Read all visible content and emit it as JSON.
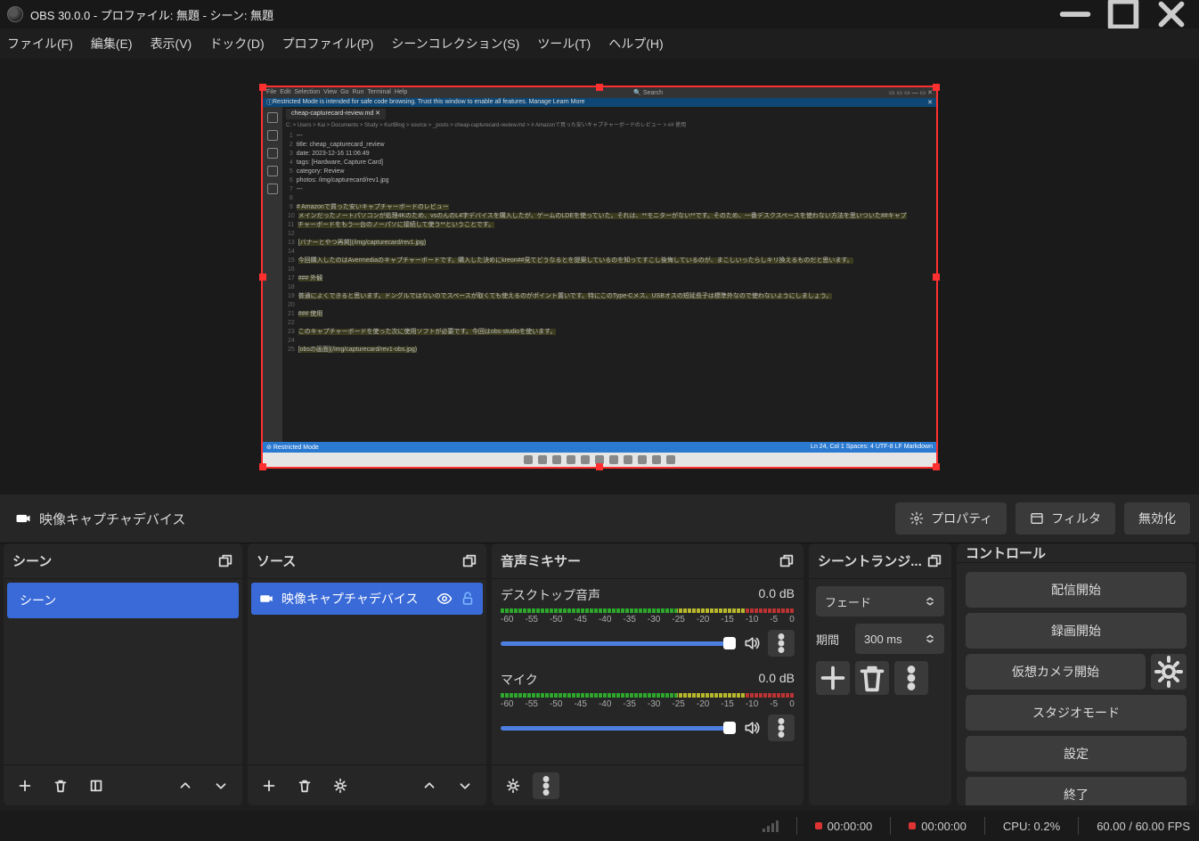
{
  "window": {
    "title": "OBS 30.0.0 - プロファイル: 無題 - シーン: 無題"
  },
  "menu": {
    "file": "ファイル(F)",
    "edit": "編集(E)",
    "view": "表示(V)",
    "dock": "ドック(D)",
    "profile": "プロファイル(P)",
    "scenecol": "シーンコレクション(S)",
    "tools": "ツール(T)",
    "help": "ヘルプ(H)"
  },
  "vscode": {
    "menus": [
      "File",
      "Edit",
      "Selection",
      "View",
      "Go",
      "Run",
      "Terminal",
      "Help"
    ],
    "search_placeholder": "Search",
    "banner": "Restricted Mode is intended for safe code browsing. Trust this window to enable all features.   Manage   Learn More",
    "tab": "cheap-capturecard-review.md",
    "breadcrumb": "C: > Users > Kai > Documents > Study > KurtBlog > source > _posts > cheap-capturecard-review.md > # Amazonで買った安いキャプチャーボードのレビュー > ## 使用",
    "lines": [
      "---",
      "title: cheap_capturecard_review",
      "date: 2023-12-16 11:06:49",
      "tags: [Hardware, Capture Card]",
      "category: Review",
      "photos: /img/capturecard/rev1.jpg",
      "---",
      "",
      "# Amazonで買った安いキャプチャーボードのレビュー",
      "メインだったノートパソコンが処理4Kのため、vsのんのL4字デバイスを購入したが、ゲームのLDEを使っていた。それは、**モニターがない**です。そのため、一番デスクスペースを使わない方法を思いついた##キャプ",
      "チャーボードをもう一台のノーパソに接続して使う**ということです。",
      "",
      "[バナーとやつ再掲](/img/capturecard/rev1.jpg)",
      "",
      "今回購入したのはAvermediaのキャプチャーボードです。購入した決めにkreon##見てどうなるとを提案しているのを知ってすこし後悔しているのが、まこしいったらしキリ換えるものだと思います。",
      "",
      "### 外観",
      "",
      "普通によくできると思います。ドングルではないのでスペースが取くても使えるのがポイント置いです。特にこのType-Cメス、USBオスの短延長子は標準外なので使わないようにしましょう。",
      "",
      "### 使用",
      "",
      "このキャプチャーボードを使った次に使用ソフトが必要です。今回はobs-studioを使います。",
      "",
      "[obsの画面](/img/capturecard/rev1-obs.jpg)"
    ],
    "status_left": "Restricted Mode",
    "status_right": "Ln 24, Col 1  Spaces: 4  UTF-8  LF  Markdown"
  },
  "ctxbar": {
    "selected_source": "映像キャプチャデバイス",
    "prop": "プロパティ",
    "filter": "フィルタ",
    "disable": "無効化"
  },
  "docks": {
    "scenes_title": "シーン",
    "sources_title": "ソース",
    "mixer_title": "音声ミキサー",
    "trans_title": "シーントランジ...",
    "ctrl_title": "コントロール"
  },
  "scenes": {
    "items": [
      "シーン"
    ]
  },
  "sources": {
    "items": [
      {
        "name": "映像キャプチャデバイス"
      }
    ]
  },
  "mixer": {
    "ch1": {
      "name": "デスクトップ音声",
      "level": "0.0 dB"
    },
    "ch2": {
      "name": "マイク",
      "level": "0.0 dB"
    },
    "ticks": [
      "-60",
      "-55",
      "-50",
      "-45",
      "-40",
      "-35",
      "-30",
      "-25",
      "-20",
      "-15",
      "-10",
      "-5",
      "0"
    ]
  },
  "trans": {
    "type": "フェード",
    "dur_label": "期間",
    "duration": "300 ms"
  },
  "controls": {
    "stream": "配信開始",
    "record": "録画開始",
    "vcam": "仮想カメラ開始",
    "studio": "スタジオモード",
    "settings": "設定",
    "exit": "終了"
  },
  "status": {
    "live_time": "00:00:00",
    "rec_time": "00:00:00",
    "cpu": "CPU: 0.2%",
    "fps": "60.00 / 60.00 FPS"
  }
}
